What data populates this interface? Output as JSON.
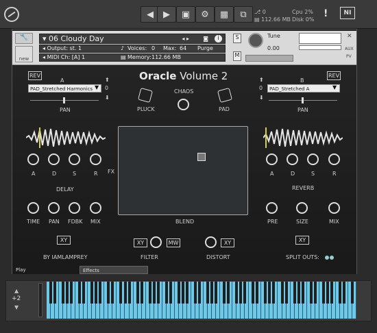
{
  "topbar": {
    "prev": "◀",
    "next": "▶",
    "midi_in": "0",
    "memory": "112.66 MB",
    "cpu_label": "Cpu",
    "cpu_val": "2%",
    "disk_label": "Disk",
    "disk_val": "0%",
    "alert": "!",
    "ni": "NI"
  },
  "instrument": {
    "name": "06 Cloudy Day",
    "output_label": "Output:",
    "output_val": "st. 1",
    "voices_label": "Voices:",
    "voices_val": "0",
    "max_label": "Max:",
    "max_val": "64",
    "purge": "Purge",
    "midi_label": "MIDI Ch:",
    "midi_val": "[A]  1",
    "memory_label": "Memory:",
    "memory_val": "112.66 MB",
    "s": "S",
    "m": "M",
    "tune_label": "Tune",
    "tune_val": "0.00",
    "aux": "AUX",
    "pv": "PV",
    "new_label": "new"
  },
  "title": {
    "bold": "Oracle",
    "rest": " Volume 2"
  },
  "left": {
    "rev": "REV",
    "letter": "A",
    "preset": "PAD_Stretched Harmonics",
    "num": "0",
    "pan": "PAN",
    "adsr": [
      "A",
      "D",
      "S",
      "R"
    ],
    "delay": "DELAY",
    "fx": "FX",
    "delay_knobs": [
      "TIME",
      "PAN",
      "FDBK",
      "MIX"
    ],
    "xy": "XY",
    "credit": "BY IAMLAMPREY"
  },
  "right": {
    "rev": "REV",
    "letter": "B",
    "preset": "PAD_Stretched A",
    "num": "0",
    "pan": "PAN",
    "adsr": [
      "A",
      "D",
      "S",
      "R"
    ],
    "reverb": "REVERB",
    "reverb_knobs": [
      "PRE",
      "SIZE",
      "MIX"
    ],
    "xy": "XY",
    "split": "SPLIT OUTS:"
  },
  "center": {
    "pluck": "PLUCK",
    "chaos": "CHAOS",
    "pad": "PAD",
    "blend": "BLEND",
    "xy_left": "XY",
    "mw": "MW",
    "xy_right": "XY",
    "filter": "FILTER",
    "distort": "DISTORT"
  },
  "tabs": {
    "play": "Play",
    "effects": "Effects"
  },
  "keyboard": {
    "octave": "+2"
  }
}
